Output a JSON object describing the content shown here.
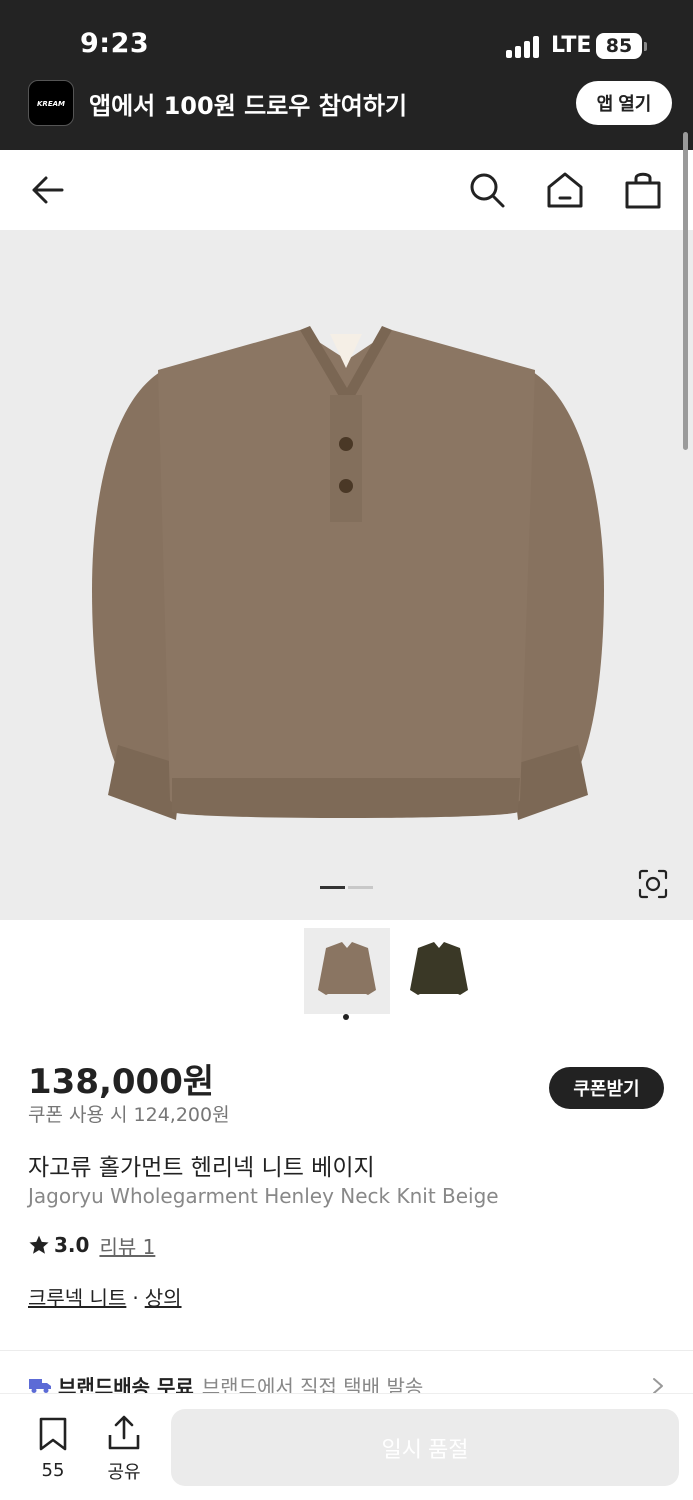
{
  "status_bar": {
    "time": "9:23",
    "network": "LTE",
    "battery": "85",
    "signal_bars_active": 4
  },
  "app_banner": {
    "logo_text": "KREAM",
    "text": "앱에서 100원 드로우 참여하기",
    "open_button": "앱 열기"
  },
  "nav": {
    "icons": [
      "back-arrow-icon",
      "search-icon",
      "home-icon",
      "shopping-bag-icon"
    ]
  },
  "gallery": {
    "image_count": 2,
    "active_index": 0,
    "lens_icon": "image-search-icon",
    "colors": {
      "beige": "#8a7562",
      "olive": "#3a3826",
      "background": "#ececec"
    }
  },
  "thumbnails": [
    {
      "variant": "beige",
      "selected": true
    },
    {
      "variant": "olive",
      "selected": false
    }
  ],
  "product": {
    "price": "138,000원",
    "coupon_price": "쿠폰 사용 시 124,200원",
    "coupon_button": "쿠폰받기",
    "name_ko": "자고류 홀가먼트 헨리넥 니트 베이지",
    "name_en": "Jagoryu Wholegarment Henley Neck Knit Beige",
    "rating": "3.0",
    "review_link": "리뷰 1",
    "category_1": "크루넥 니트",
    "category_separator": "·",
    "category_2": "상의"
  },
  "shipping": {
    "label": "브랜드배송 무료",
    "description": "브랜드에서 직접 택배 발송",
    "accent": "#5c6bd6"
  },
  "bottom_bar": {
    "bookmark_count": "55",
    "share_label": "공유",
    "main_button": "일시 품절"
  }
}
